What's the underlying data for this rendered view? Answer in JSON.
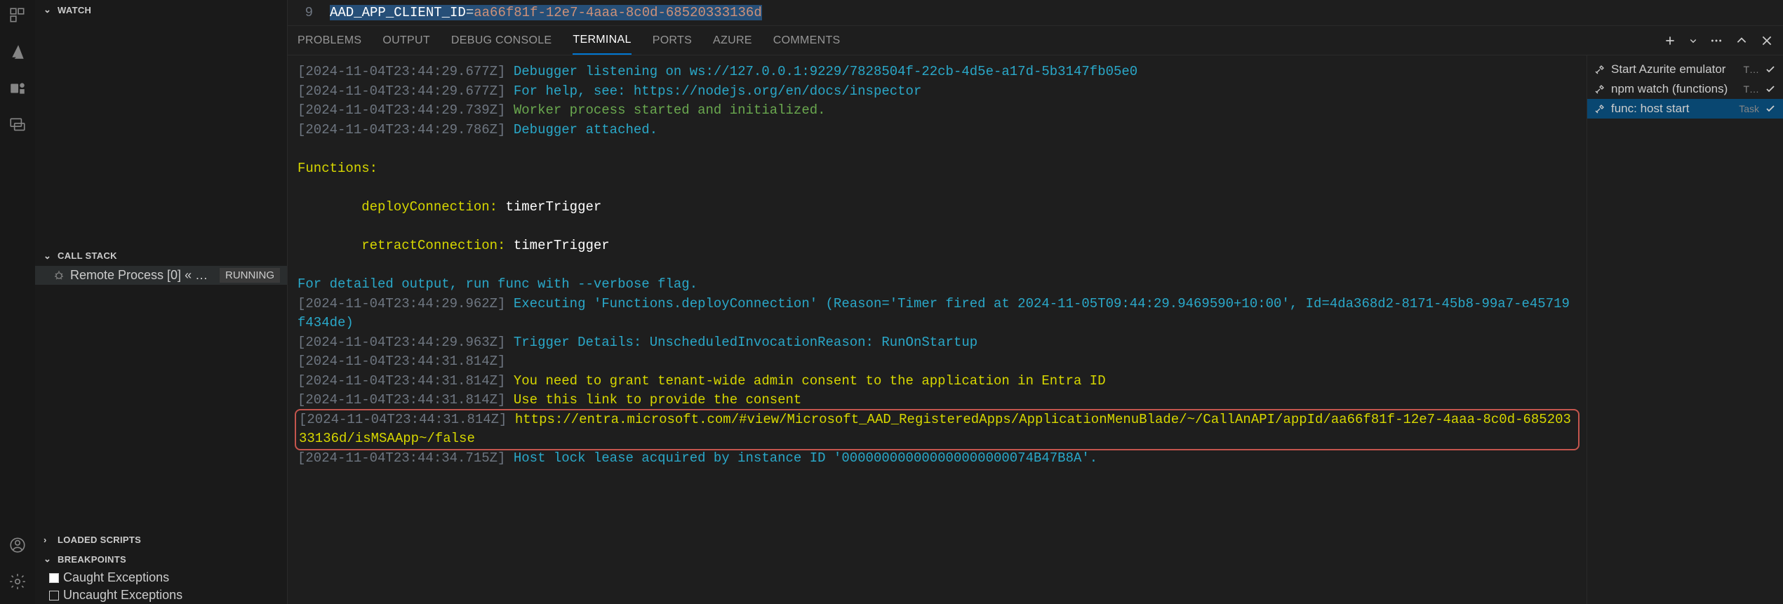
{
  "editor": {
    "line_no": "9",
    "var": "AAD_APP_CLIENT_ID",
    "op": "=",
    "val": "aa66f81f-12e7-4aaa-8c0d-68520333136d"
  },
  "sidebar": {
    "watch_title": "WATCH",
    "callstack_title": "CALL STACK",
    "callstack_item": "Remote Process [0] « …",
    "callstack_status": "RUNNING",
    "loaded_scripts_title": "LOADED SCRIPTS",
    "breakpoints_title": "BREAKPOINTS",
    "bp_caught": "Caught Exceptions",
    "bp_uncaught": "Uncaught Exceptions"
  },
  "panel_tabs": {
    "problems": "PROBLEMS",
    "output": "OUTPUT",
    "debug_console": "DEBUG CONSOLE",
    "terminal": "TERMINAL",
    "ports": "PORTS",
    "azure": "AZURE",
    "comments": "COMMENTS"
  },
  "tasks": [
    {
      "label": "Start Azurite emulator",
      "type": "T…"
    },
    {
      "label": "npm watch (functions)",
      "type": "T…"
    },
    {
      "label": "func: host start",
      "type": "Task"
    }
  ],
  "terminal": {
    "l1_ts": "[2024-11-04T23:44:29.677Z] ",
    "l1_msg": "Debugger listening on ws://127.0.0.1:9229/7828504f-22cb-4d5e-a17d-5b3147fb05e0",
    "l2_ts": "[2024-11-04T23:44:29.677Z] ",
    "l2_msg": "For help, see: https://nodejs.org/en/docs/inspector",
    "l3_ts": "[2024-11-04T23:44:29.739Z] ",
    "l3_msg": "Worker process started and initialized.",
    "l4_ts": "[2024-11-04T23:44:29.786Z] ",
    "l4_msg": "Debugger attached.",
    "l5_head": "Functions:",
    "l6": "        deployConnection: ",
    "l6w": "timerTrigger",
    "l7": "        retractConnection: ",
    "l7w": "timerTrigger",
    "l8": "For detailed output, run func with --verbose flag.",
    "l9_ts": "[2024-11-04T23:44:29.962Z] ",
    "l9_msg": "Executing 'Functions.deployConnection' (Reason='Timer fired at 2024-11-05T09:44:29.9469590+10:00', Id=4da368d2-8171-45b8-99a7-e45719f434de)",
    "l10_ts": "[2024-11-04T23:44:29.963Z] ",
    "l10_msg": "Trigger Details: UnscheduledInvocationReason: RunOnStartup",
    "l11_ts": "[2024-11-04T23:44:31.814Z]",
    "l12_ts": "[2024-11-04T23:44:31.814Z] ",
    "l12_msg": "You need to grant tenant-wide admin consent to the application in Entra ID",
    "l13_ts": "[2024-11-04T23:44:31.814Z] ",
    "l13_msg": "Use this link to provide the consent",
    "l14_ts": "[2024-11-04T23:44:31.814Z] ",
    "l14_msg": "https://entra.microsoft.com/#view/Microsoft_AAD_RegisteredApps/ApplicationMenuBlade/~/CallAnAPI/appId/aa66f81f-12e7-4aaa-8c0d-68520333136d/isMSAApp~/false",
    "l15_ts": "[2024-11-04T23:44:34.715Z] ",
    "l15_msg": "Host lock lease acquired by instance ID '000000000000000000000074B47B8A'."
  }
}
